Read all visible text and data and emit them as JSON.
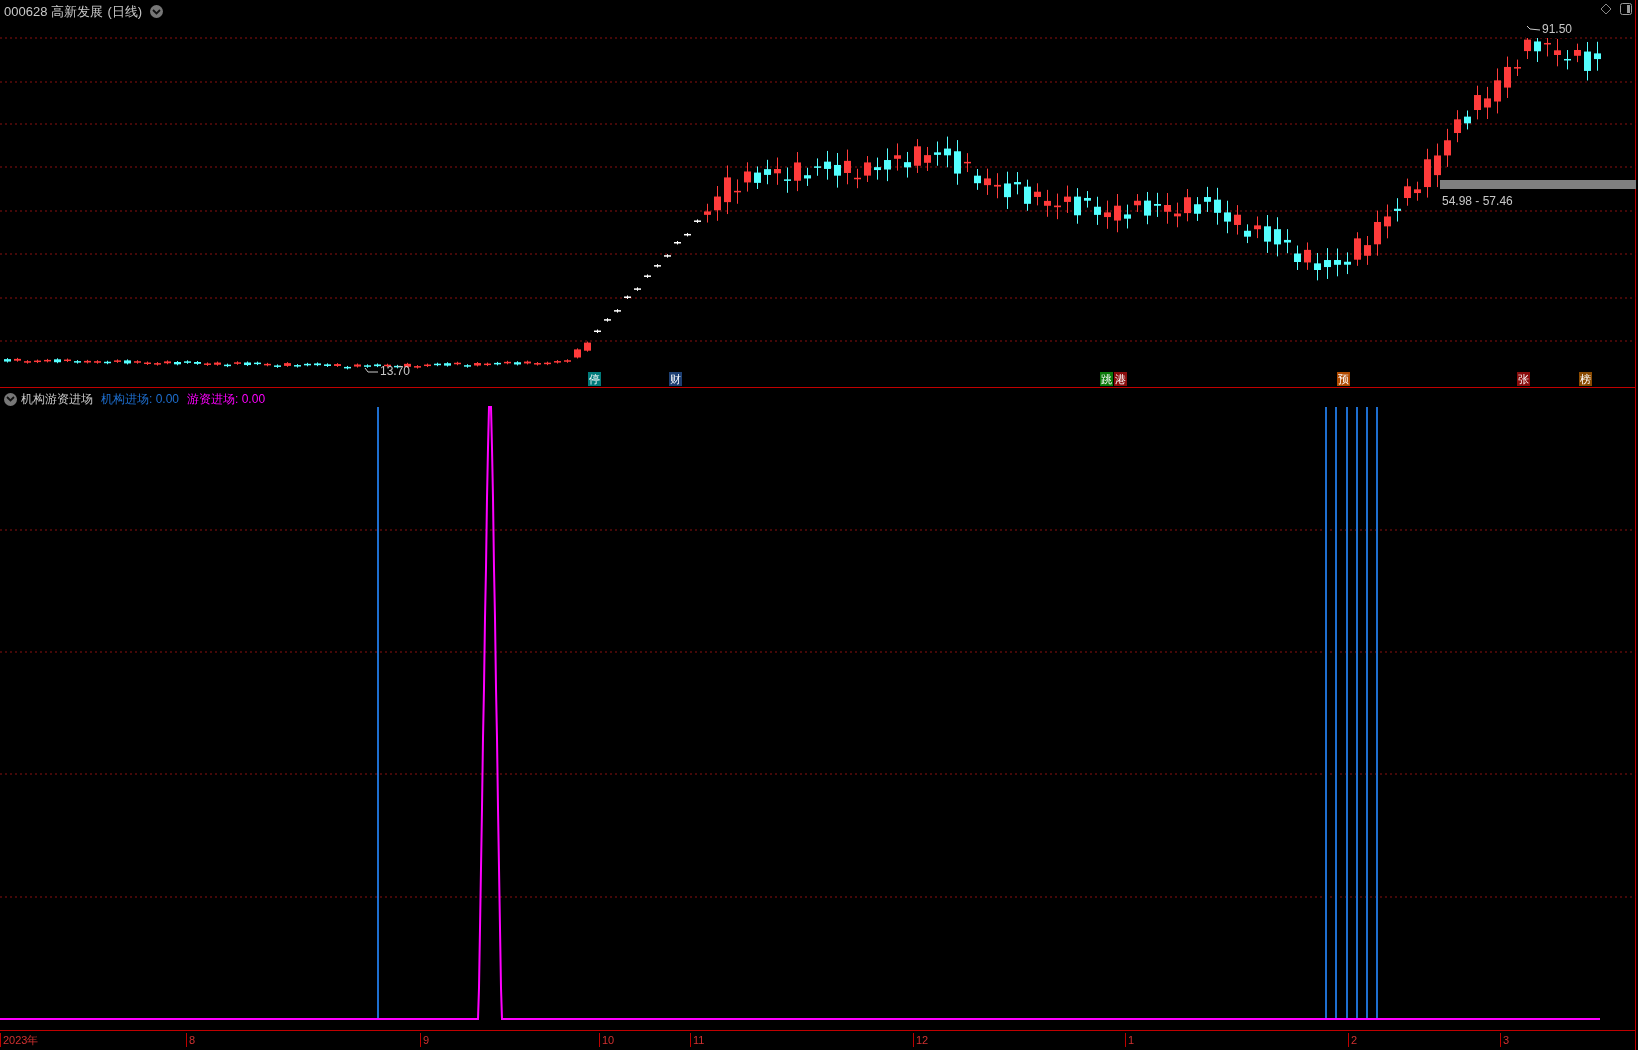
{
  "header": {
    "code": "000628",
    "name": "高新发展",
    "period": "(日线)"
  },
  "price_labels": {
    "high": "91.50",
    "low": "13.70",
    "range": "54.98 - 57.46"
  },
  "events": [
    {
      "label": "停",
      "color": "#007a7a"
    },
    {
      "label": "财",
      "color": "#1d3f73"
    },
    {
      "label": "跳",
      "color": "#0b7a0b"
    },
    {
      "label": "港",
      "color": "#8a0c0c"
    },
    {
      "label": "预",
      "color": "#b04a00"
    },
    {
      "label": "张",
      "color": "#8a0c0c"
    },
    {
      "label": "榜",
      "color": "#8a4a00"
    }
  ],
  "indicator": {
    "name": "机构游资进场",
    "legend": [
      {
        "label": "机构进场: 0.00",
        "color": "#1e6fd0"
      },
      {
        "label": "游资进场: 0.00",
        "color": "#ff00ff"
      }
    ]
  },
  "x_axis": [
    "2023年",
    "8",
    "9",
    "10",
    "11",
    "12",
    "1",
    "2",
    "3"
  ]
}
